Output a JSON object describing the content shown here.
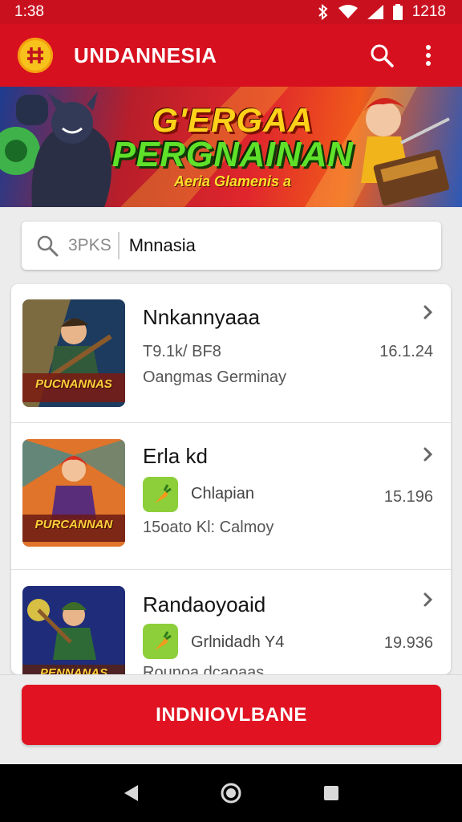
{
  "status_bar": {
    "time": "1:38",
    "clock_right": "1218"
  },
  "app_bar": {
    "title": "UNDANNESIA",
    "logo_glyph": "#"
  },
  "banner": {
    "line1": "G'ERGAA",
    "line2": "PERGNAINAN",
    "line3": "Aeria Glamenis a"
  },
  "search": {
    "hint": "3PKS",
    "value": "Mnnasia"
  },
  "list": [
    {
      "title": "Nnkannyaaa",
      "meta": "T9.1k/ BF8",
      "subtitle": "Oangmas Germinay",
      "number": "16.1.24",
      "thumb_label": "PUCNANNAS"
    },
    {
      "title": "Erla kd",
      "mini_label": "Chlapian",
      "subtitle": "15oato Kl: Calmoy",
      "number": "15.196",
      "thumb_label": "PURCANNAN"
    },
    {
      "title": "Randaoyoaid",
      "mini_label": "Grlnidadh Y4",
      "subtitle": "Rounoa dcaoaas",
      "number": "19.936",
      "thumb_label": "PENNANAS"
    }
  ],
  "cta": {
    "label": "INDNIOVLBANE"
  },
  "colors": {
    "primary": "#d7101f",
    "status": "#c9101f",
    "cta": "#e11322",
    "logo": "#f7c21c"
  },
  "icons": [
    "bluetooth-icon",
    "wifi-icon",
    "signal-icon",
    "battery-icon",
    "search-icon",
    "more-vert-icon",
    "chevron-right-icon",
    "back-icon",
    "home-icon",
    "recents-icon"
  ]
}
